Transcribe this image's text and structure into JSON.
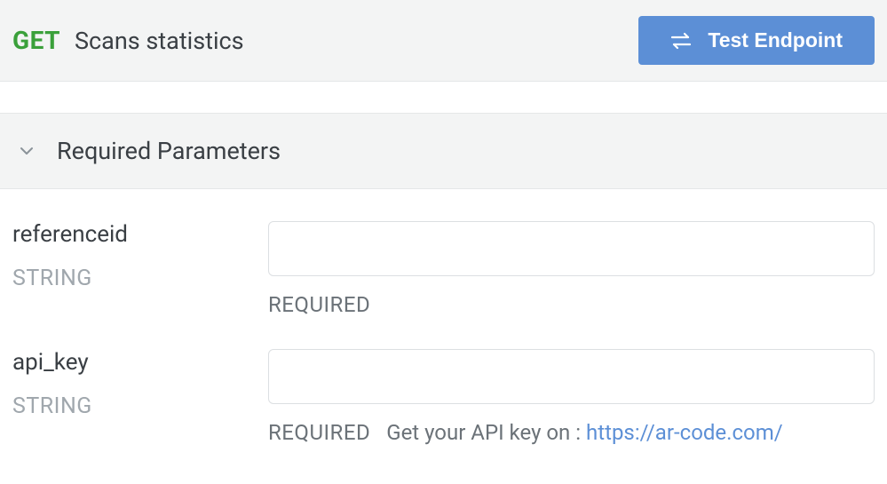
{
  "header": {
    "method": "GET",
    "title": "Scans statistics",
    "test_button_label": "Test Endpoint"
  },
  "section": {
    "title": "Required Parameters"
  },
  "params": [
    {
      "name": "referenceid",
      "type": "STRING",
      "required_tag": "REQUIRED",
      "value": "",
      "description": "",
      "link_text": "",
      "link_href": ""
    },
    {
      "name": "api_key",
      "type": "STRING",
      "required_tag": "REQUIRED",
      "value": "",
      "description": "Get your API key on : ",
      "link_text": "https://ar-code.com/",
      "link_href": "https://ar-code.com/"
    }
  ]
}
